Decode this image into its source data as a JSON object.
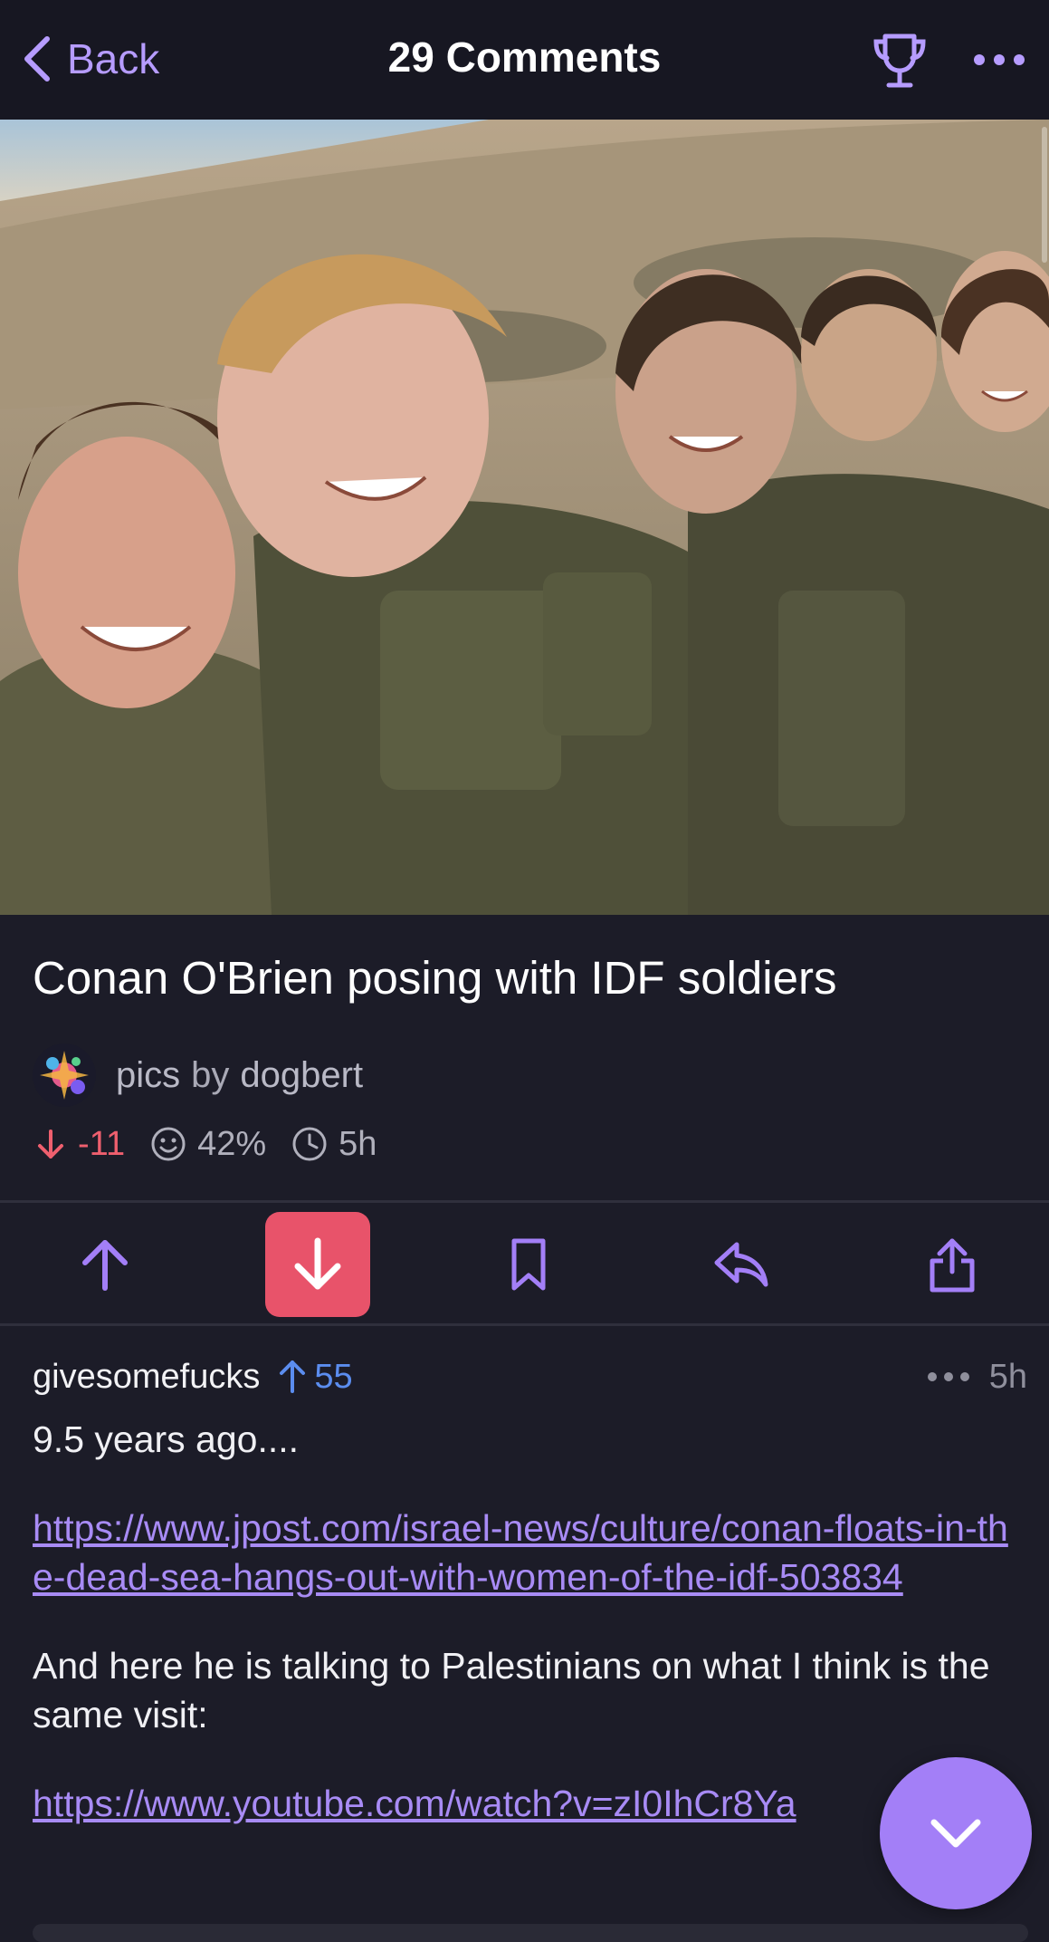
{
  "nav": {
    "back_label": "Back",
    "title": "29 Comments",
    "trophy_icon": "trophy-icon",
    "more_icon": "more-horizontal-icon"
  },
  "post": {
    "title": "Conan O'Brien posing with IDF soldiers",
    "community": "pics",
    "by_text": "by",
    "author": "dogbert",
    "score": "-11",
    "upvote_ratio": "42%",
    "age": "5h"
  },
  "actions": {
    "upvote_icon": "arrow-up-icon",
    "downvote_icon": "arrow-down-icon",
    "downvote_active": true,
    "save_icon": "bookmark-icon",
    "reply_icon": "reply-icon",
    "share_icon": "share-icon"
  },
  "comment": {
    "author": "givesomefucks",
    "votes": "55",
    "age": "5h",
    "body_line1": "9.5 years ago....",
    "link1": "https://www.jpost.com/israel-news/culture/conan-floats-in-the-dead-sea-hangs-out-with-women-of-the-idf-503834",
    "body_line2": "And here he is talking to Palestinians on what I think is the same visit:",
    "link2": "https://www.youtube.com/watch?v=zI0IhCr8Ya"
  },
  "colors": {
    "accent": "#a37ff7",
    "downvote": "#e8536a",
    "upvote_blue": "#5b8def",
    "background": "#1c1c28"
  }
}
